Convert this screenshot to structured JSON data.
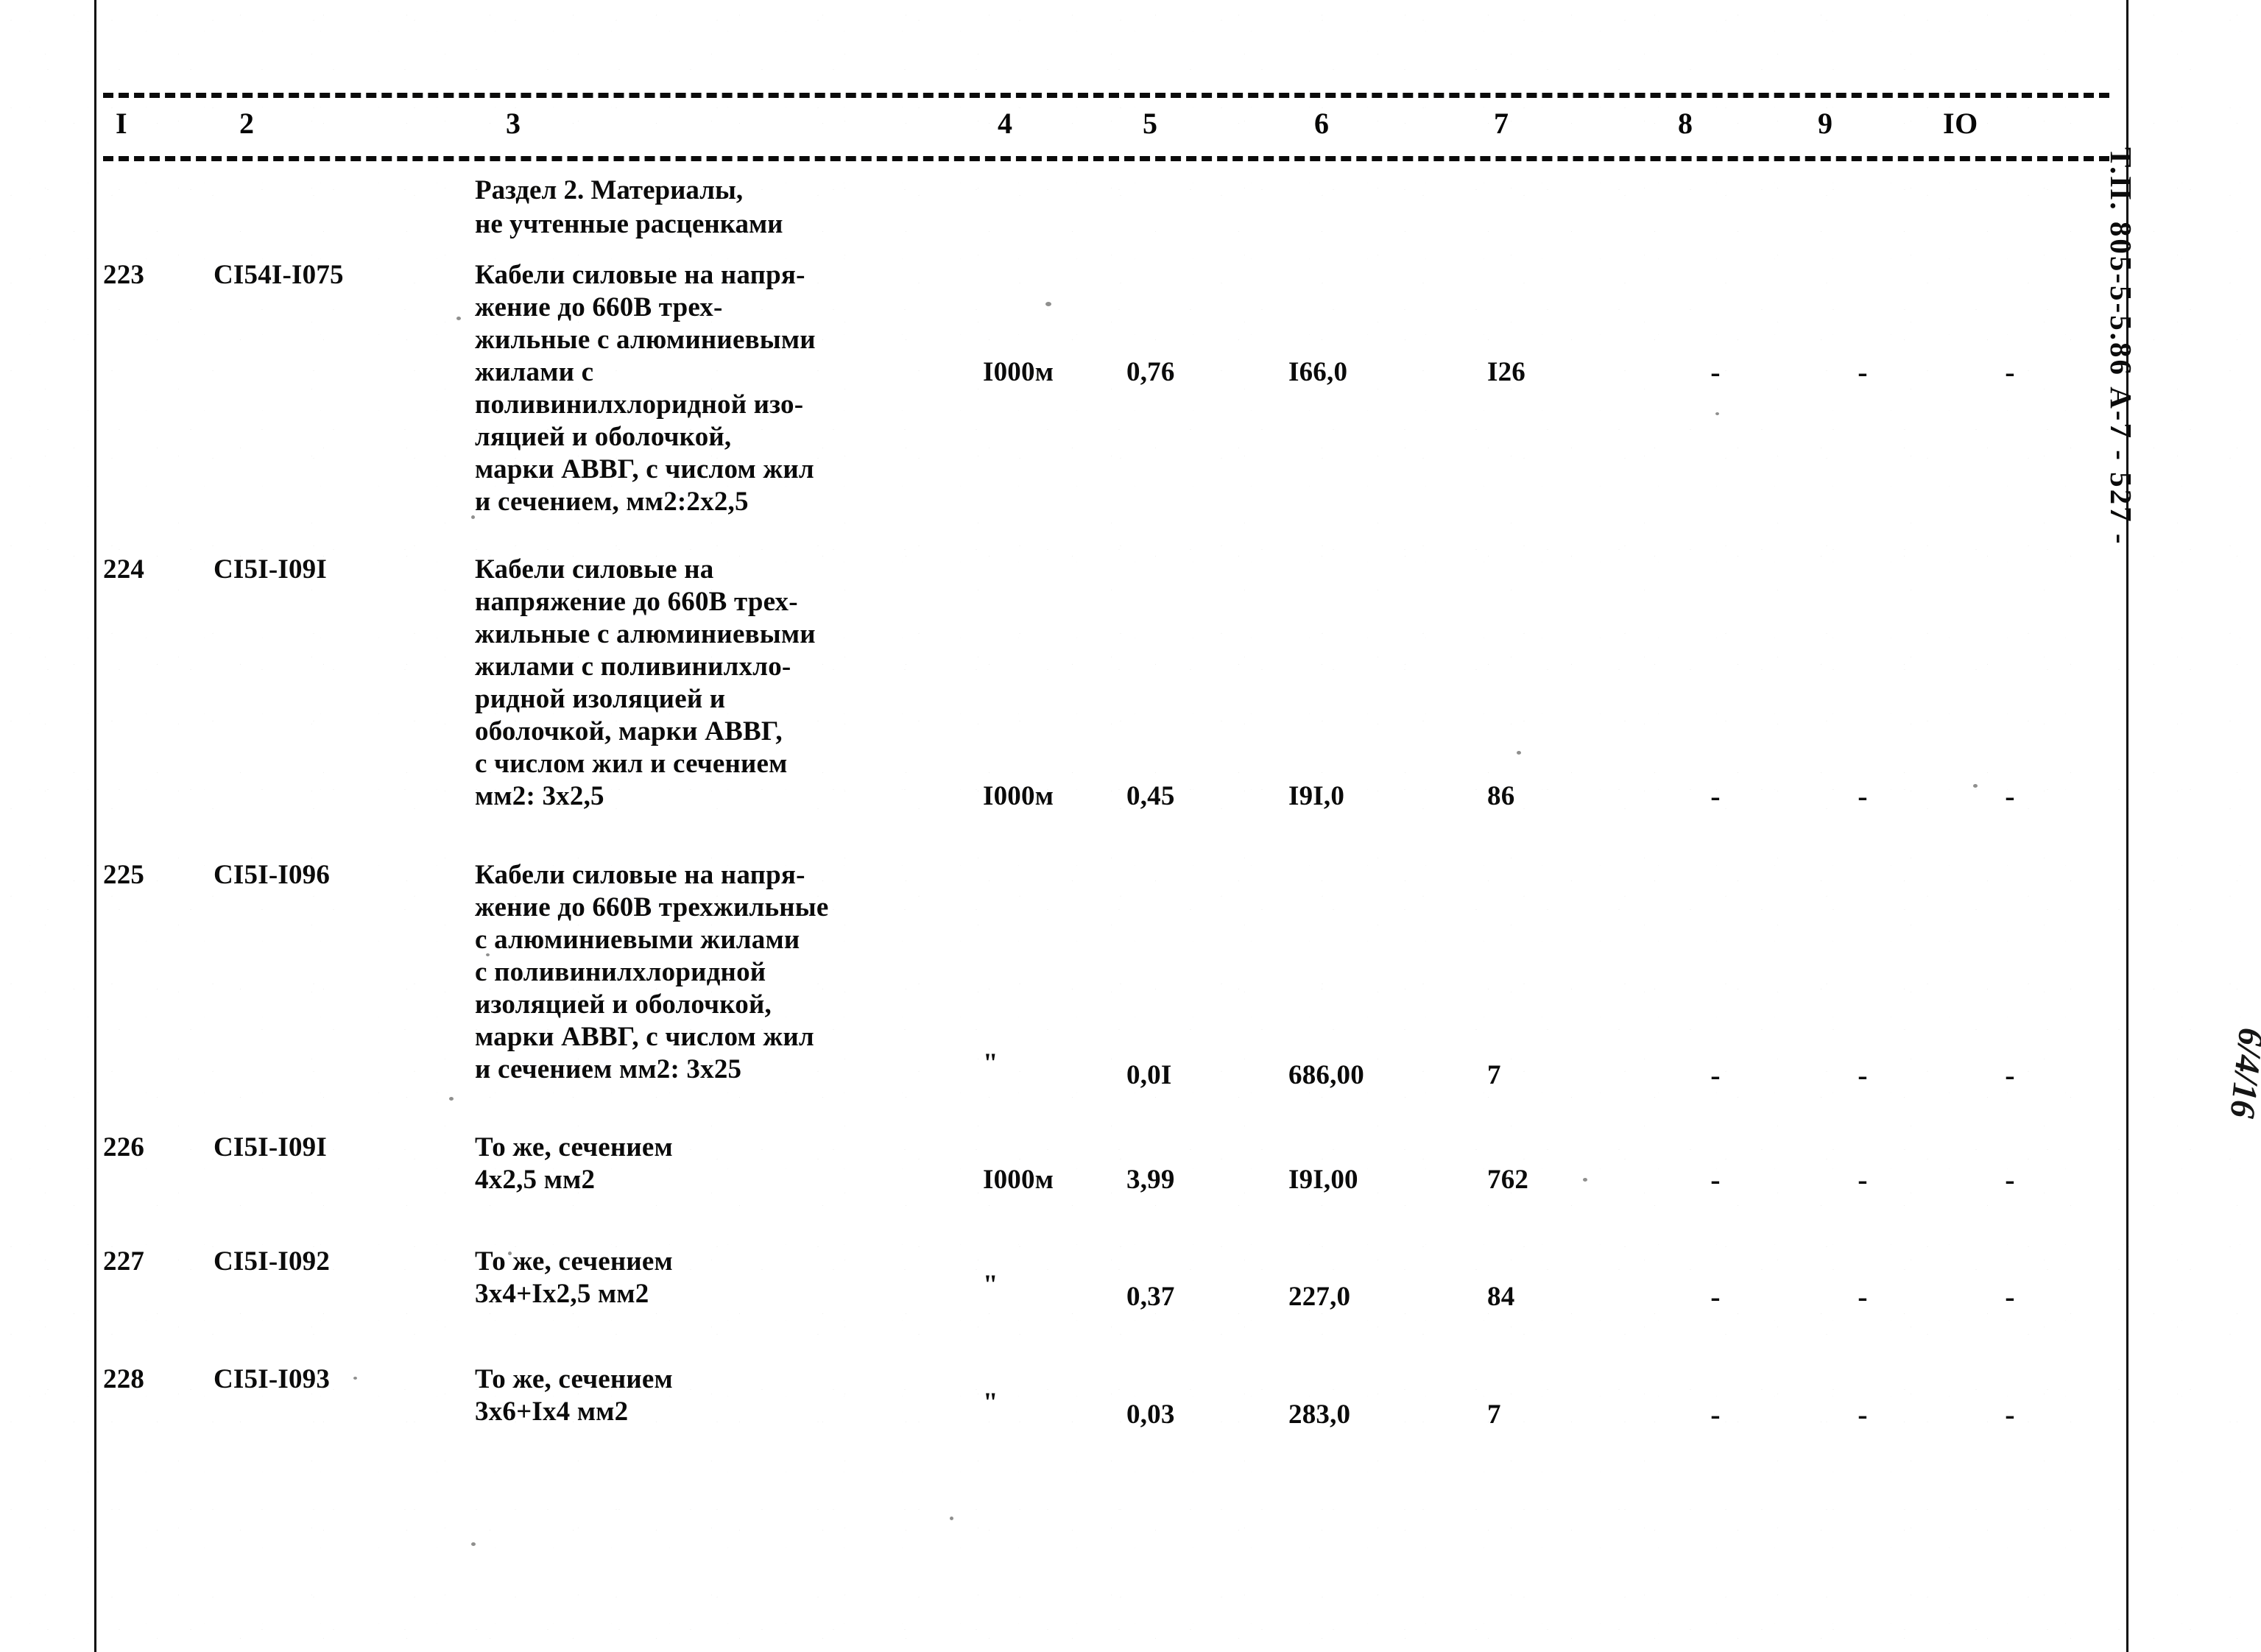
{
  "document": {
    "title_stamp": "Т.П. 805-5-5.86   А-7   - 527 -",
    "handwritten_mark": "6/4/16"
  },
  "table": {
    "column_headers": [
      "I",
      "2",
      "3",
      "4",
      "5",
      "6",
      "7",
      "8",
      "9",
      "IO"
    ],
    "section_title": "Раздел 2. Материалы,\nне учтенные расценками",
    "rows": [
      {
        "num": "223",
        "code": "CI54I-I075",
        "desc": "Кабели силовые на напря-\nжение до 660В трех-\nжильные с алюминиевыми\nжилами с\nполивинилхлоридной изо-\nляцией и оболочкой,\nмарки АВВГ, с числом жил\nи сечением, мм2:2х2,5",
        "unit": "I000м",
        "qty": "0,76",
        "price": "I66,0",
        "total": "I26",
        "col8": "-",
        "col9": "-",
        "col10": "-"
      },
      {
        "num": "224",
        "code": "CI5I-I09I",
        "desc": "Кабели силовые на\nнапряжение до 660В трех-\nжильные с алюминиевыми\nжилами с поливинилхло-\nридной изоляцией и\nоболочкой, марки АВВГ,\nс числом жил и сечением\nмм2: 3х2,5",
        "unit": "I000м",
        "qty": "0,45",
        "price": "I9I,0",
        "total": "86",
        "col8": "-",
        "col9": "-",
        "col10": "-"
      },
      {
        "num": "225",
        "code": "CI5I-I096",
        "desc": "Кабели силовые на напря-\nжение до 660В трехжильные\nс алюминиевыми жилами\nс поливинилхлоридной\nизоляцией и оболочкой,\nмарки АВВГ, с числом жил\nи сечением мм2: 3х25",
        "unit": "\"",
        "qty": "0,0I",
        "price": "686,00",
        "total": "7",
        "col8": "-",
        "col9": "-",
        "col10": "-"
      },
      {
        "num": "226",
        "code": "CI5I-I09I",
        "desc": "То же, сечением\n4х2,5 мм2",
        "unit": "I000м",
        "qty": "3,99",
        "price": "I9I,00",
        "total": "762",
        "col8": "-",
        "col9": "-",
        "col10": "-"
      },
      {
        "num": "227",
        "code": "CI5I-I092",
        "desc": "То же, сечением\n3х4+Iх2,5 мм2",
        "unit": "\"",
        "qty": "0,37",
        "price": "227,0",
        "total": "84",
        "col8": "-",
        "col9": "-",
        "col10": "-"
      },
      {
        "num": "228",
        "code": "CI5I-I093",
        "desc": "То же, сечением\n3х6+Iх4 мм2",
        "unit": "\"",
        "qty": "0,03",
        "price": "283,0",
        "total": "7",
        "col8": "-",
        "col9": "-",
        "col10": "-"
      }
    ]
  }
}
